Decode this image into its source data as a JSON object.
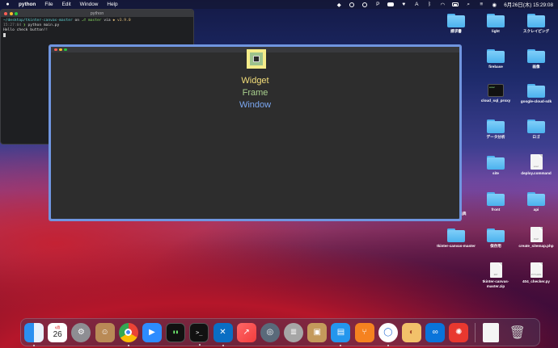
{
  "menubar": {
    "app_name": "python",
    "menus": [
      "File",
      "Edit",
      "Window",
      "Help"
    ],
    "clock": "6月26日(木)  15:29:08"
  },
  "terminal": {
    "title": "python",
    "prompt_path": "~/desktop/tkinter-canvas-master",
    "prompt_on": "on",
    "branch": "master",
    "via": "via",
    "version": "v3.9.0",
    "time": "15:27:04",
    "command": "python main.py",
    "output": "Hello check button!!"
  },
  "desktop_icons": [
    {
      "label": "請求書",
      "type": "folder"
    },
    {
      "label": "light",
      "type": "folder"
    },
    {
      "label": "スクレイピング",
      "type": "folder"
    },
    {
      "label": "firebase",
      "type": "folder"
    },
    {
      "label": "画像",
      "type": "folder"
    },
    {
      "label": "cloud_sql_proxy",
      "type": "exec"
    },
    {
      "label": "google-cloud-sdk",
      "type": "folder"
    },
    {
      "label": "データ分析",
      "type": "folder"
    },
    {
      "label": "ロゴ",
      "type": "folder"
    },
    {
      "label": "site",
      "type": "folder"
    },
    {
      "label": "deploy.command",
      "type": "doc"
    },
    {
      "label": "front",
      "type": "folder"
    },
    {
      "label": "api",
      "type": "folder"
    },
    {
      "label": "tkinter-canvas-master",
      "type": "folder"
    },
    {
      "label": "保存用",
      "type": "folder"
    },
    {
      "label": "create_sitemap.php",
      "type": "doc"
    },
    {
      "label": "tkinter-canvas-master.zip",
      "type": "doc"
    },
    {
      "label": "404_checker.py",
      "type": "doc"
    },
    {
      "label": "出典",
      "type": "folder"
    }
  ],
  "tk_window": {
    "labels": {
      "widget": "Widget",
      "frame": "Frame",
      "window": "Window"
    },
    "colors": {
      "border": "#7095e0",
      "widget": "#f5df7a",
      "frame": "#a9d18e",
      "window": "#7ba7f0"
    }
  },
  "dock": {
    "calendar_month": "6月",
    "calendar_day": "26"
  }
}
